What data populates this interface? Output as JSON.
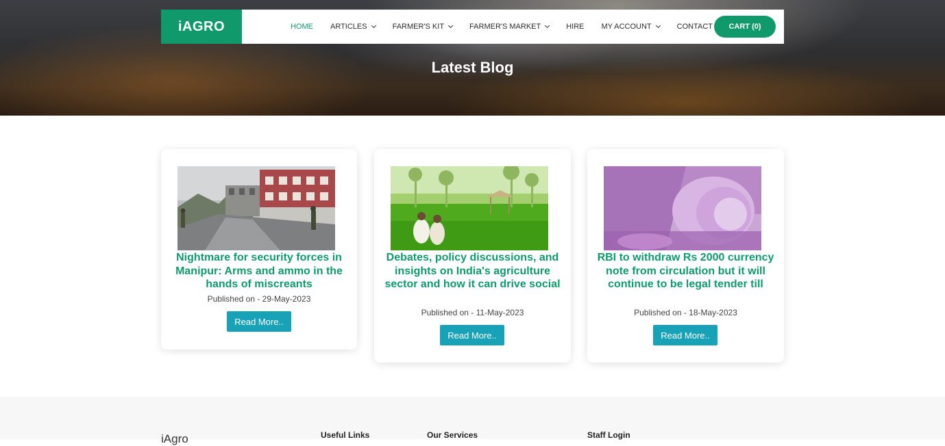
{
  "brand": "iAGRO",
  "colors": {
    "accent": "#109a6c",
    "button": "#17a2b8"
  },
  "nav": {
    "items": [
      {
        "label": "HOME",
        "dropdown": false,
        "active": true
      },
      {
        "label": "ARTICLES",
        "dropdown": true
      },
      {
        "label": "FARMER'S KIT",
        "dropdown": true
      },
      {
        "label": "FARMER'S MARKET",
        "dropdown": true
      },
      {
        "label": "HIRE",
        "dropdown": false
      },
      {
        "label": "MY ACCOUNT",
        "dropdown": true
      },
      {
        "label": "CONTACT",
        "dropdown": false
      }
    ],
    "cart_label": "CART (0)"
  },
  "hero": {
    "title": "Latest Blog"
  },
  "posts": [
    {
      "title": "Nightmare for security forces in Manipur: Arms and ammo in the hands of miscreants",
      "date": "Published on - 29-May-2023",
      "button": "Read More.."
    },
    {
      "title": "Debates, policy discussions, and insights on India's agriculture sector and how it can drive social",
      "date": "Published on - 11-May-2023",
      "button": "Read More.."
    },
    {
      "title": "RBI to withdraw Rs 2000 currency note from circulation but it will continue to be legal tender till",
      "date": "Published on - 18-May-2023",
      "button": "Read More.."
    }
  ],
  "footer": {
    "logo": "iAgro",
    "useful_links": "Useful Links",
    "our_services": "Our Services",
    "staff_login": "Staff Login"
  }
}
